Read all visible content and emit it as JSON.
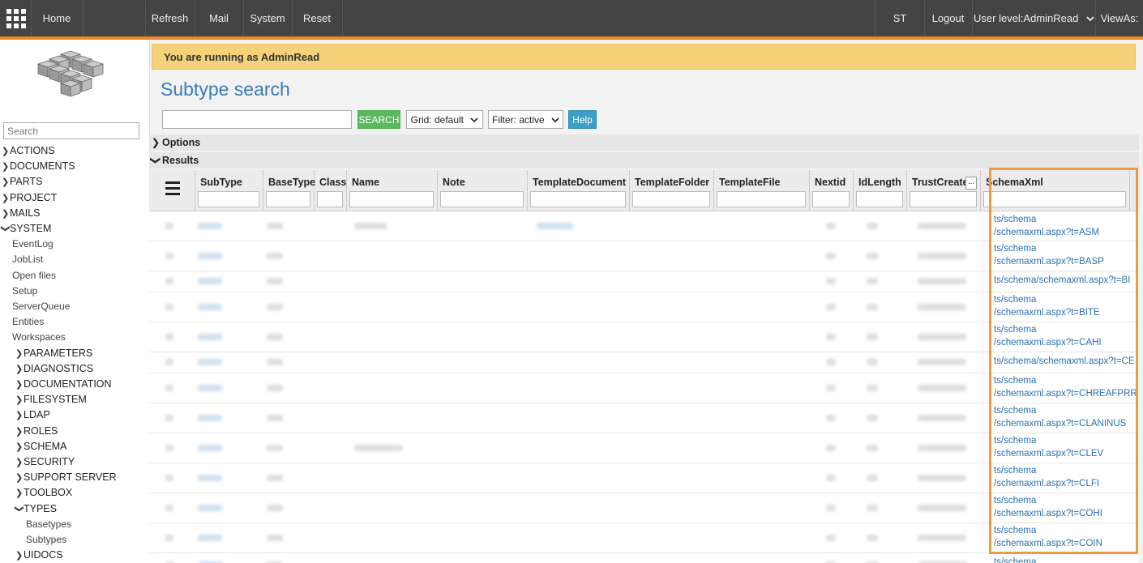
{
  "topbar": {
    "home": "Home",
    "refresh": "Refresh",
    "mail": "Mail",
    "system": "System",
    "reset": "Reset",
    "st": "ST",
    "logout": "Logout",
    "user_level": "User level:AdminRead",
    "view_as": "ViewAs:"
  },
  "sidebar": {
    "search_placeholder": "Search",
    "items": [
      {
        "label": "ACTIONS",
        "type": "collapsed"
      },
      {
        "label": "DOCUMENTS",
        "type": "collapsed"
      },
      {
        "label": "PARTS",
        "type": "collapsed"
      },
      {
        "label": "PROJECT",
        "type": "collapsed"
      },
      {
        "label": "MAILS",
        "type": "collapsed"
      },
      {
        "label": "SYSTEM",
        "type": "expanded"
      },
      {
        "label": "EventLog",
        "type": "leaf"
      },
      {
        "label": "JobList",
        "type": "leaf"
      },
      {
        "label": "Open files",
        "type": "leaf"
      },
      {
        "label": "Setup",
        "type": "leaf"
      },
      {
        "label": "ServerQueue",
        "type": "leaf"
      },
      {
        "label": "Entities",
        "type": "leaf"
      },
      {
        "label": "Workspaces",
        "type": "leaf"
      },
      {
        "label": "PARAMETERS",
        "type": "collapsed"
      },
      {
        "label": "DIAGNOSTICS",
        "type": "collapsed"
      },
      {
        "label": "DOCUMENTATION",
        "type": "collapsed"
      },
      {
        "label": "FILESYSTEM",
        "type": "collapsed"
      },
      {
        "label": "LDAP",
        "type": "collapsed"
      },
      {
        "label": "ROLES",
        "type": "collapsed"
      },
      {
        "label": "SCHEMA",
        "type": "collapsed"
      },
      {
        "label": "SECURITY",
        "type": "collapsed"
      },
      {
        "label": "SUPPORT SERVER",
        "type": "collapsed"
      },
      {
        "label": "TOOLBOX",
        "type": "collapsed"
      },
      {
        "label": "TYPES",
        "type": "expanded"
      },
      {
        "label": "Basetypes",
        "type": "leaf"
      },
      {
        "label": "Subtypes",
        "type": "leaf"
      },
      {
        "label": "UIDOCS",
        "type": "collapsed"
      }
    ]
  },
  "banner": "You are running as AdminRead",
  "page_title": "Subtype search",
  "toolbar": {
    "search_button": "SEARCH",
    "grid_select": "Grid: default",
    "filter_select": "Filter: active",
    "help_button": "Help"
  },
  "sections": {
    "options": "Options",
    "results": "Results"
  },
  "columns": [
    "SubType",
    "BaseType",
    "Class",
    "Name",
    "Note",
    "TemplateDocument",
    "TemplateFolder",
    "TemplateFile",
    "Nextid",
    "IdLength",
    "TrustCreate",
    "SchemaXml"
  ],
  "trustcreate_btn": "...",
  "schema_rows": [
    {
      "line1": "ts/schema",
      "line2": "/schemaxml.aspx?t=ASM"
    },
    {
      "line1": "ts/schema",
      "line2": "/schemaxml.aspx?t=BASP"
    },
    {
      "line1": "ts/schema/schemaxml.aspx?t=BI",
      "line2": ""
    },
    {
      "line1": "ts/schema",
      "line2": "/schemaxml.aspx?t=BITE"
    },
    {
      "line1": "ts/schema",
      "line2": "/schemaxml.aspx?t=CAHI"
    },
    {
      "line1": "ts/schema/schemaxml.aspx?t=CE",
      "line2": ""
    },
    {
      "line1": "ts/schema",
      "line2": "/schemaxml.aspx?t=CHREAFPRRE"
    },
    {
      "line1": "ts/schema",
      "line2": "/schemaxml.aspx?t=CLANINUS"
    },
    {
      "line1": "ts/schema",
      "line2": "/schemaxml.aspx?t=CLEV"
    },
    {
      "line1": "ts/schema",
      "line2": "/schemaxml.aspx?t=CLFI"
    },
    {
      "line1": "ts/schema",
      "line2": "/schemaxml.aspx?t=COHI"
    },
    {
      "line1": "ts/schema",
      "line2": "/schemaxml.aspx?t=COIN"
    },
    {
      "line1": "ts/schema",
      "line2": ""
    }
  ],
  "colors": {
    "topbar": "#444444",
    "accent": "#e8871e",
    "link": "#2a6fb0",
    "search_button": "#5cb85c",
    "help_button": "#3a9fc5",
    "banner": "#f5d27a",
    "highlight": "#ef9a3c"
  }
}
